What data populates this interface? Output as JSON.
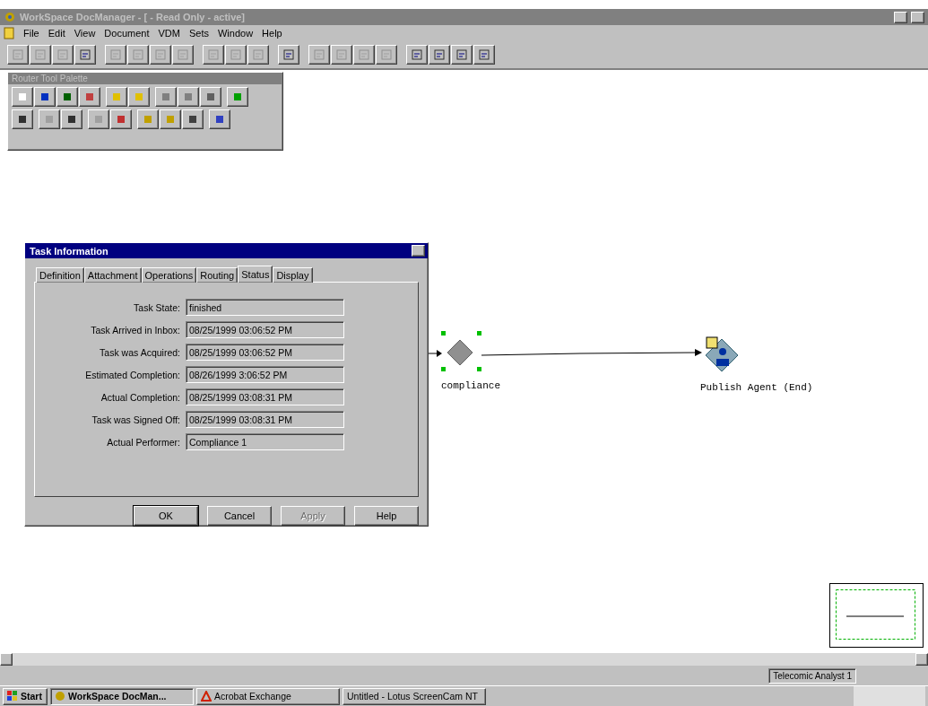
{
  "window": {
    "title": "WorkSpace DocManager - [ - Read Only - active]"
  },
  "menu": [
    "File",
    "Edit",
    "View",
    "Document",
    "VDM",
    "Sets",
    "Window",
    "Help"
  ],
  "toolbar": [
    [
      {
        "disabled": true
      },
      {
        "disabled": true
      },
      {
        "disabled": true
      },
      {
        "disabled": false
      }
    ],
    [
      {
        "disabled": true
      },
      {
        "disabled": true
      },
      {
        "disabled": true
      },
      {
        "disabled": true
      }
    ],
    [
      {
        "disabled": true
      },
      {
        "disabled": true
      },
      {
        "disabled": true
      }
    ],
    [
      {
        "disabled": false
      }
    ],
    [
      {
        "disabled": true
      },
      {
        "disabled": true
      },
      {
        "disabled": true
      },
      {
        "disabled": true
      }
    ],
    [
      {
        "disabled": false
      },
      {
        "disabled": false
      },
      {
        "disabled": false
      },
      {
        "disabled": false
      }
    ]
  ],
  "palette": {
    "title": "Router Tool Palette"
  },
  "dialog": {
    "title": "Task Information",
    "tabs": [
      {
        "label": "Definition",
        "selected": false
      },
      {
        "label": "Attachment",
        "selected": false
      },
      {
        "label": "Operations",
        "selected": false
      },
      {
        "label": "Routing",
        "selected": false
      },
      {
        "label": "Status",
        "selected": true
      },
      {
        "label": "Display",
        "selected": false
      }
    ],
    "fields": [
      {
        "label": "Task State:",
        "value": "finished"
      },
      {
        "label": "Task Arrived in Inbox:",
        "value": "08/25/1999 03:06:52 PM"
      },
      {
        "label": "Task was Acquired:",
        "value": "08/25/1999 03:06:52 PM"
      },
      {
        "label": "Estimated Completion:",
        "value": "08/26/1999 3:06:52 PM"
      },
      {
        "label": "Actual Completion:",
        "value": "08/25/1999 03:08:31 PM"
      },
      {
        "label": "Task was Signed Off:",
        "value": "08/25/1999 03:08:31 PM"
      },
      {
        "label": "Actual Performer:",
        "value": "Compliance 1"
      }
    ],
    "buttons": [
      {
        "label": "OK",
        "disabled": false
      },
      {
        "label": "Cancel",
        "disabled": false
      },
      {
        "label": "Apply",
        "disabled": true
      },
      {
        "label": "Help",
        "disabled": false
      }
    ]
  },
  "diagram": {
    "nodes": [
      {
        "kind": "task",
        "label": "compliance",
        "selected": true
      },
      {
        "kind": "agent",
        "label": "Publish Agent (End)",
        "selected": false
      }
    ]
  },
  "status_bar": {
    "user": "Telecomic Analyst 1"
  },
  "taskbar": {
    "start": "Start",
    "items": [
      {
        "label": "WorkSpace DocMan...",
        "selected": true,
        "kind": "app"
      },
      {
        "label": "Acrobat Exchange",
        "selected": false,
        "kind": "pdf"
      },
      {
        "label": "Untitled - Lotus ScreenCam NT",
        "selected": false,
        "kind": "plain"
      }
    ]
  }
}
